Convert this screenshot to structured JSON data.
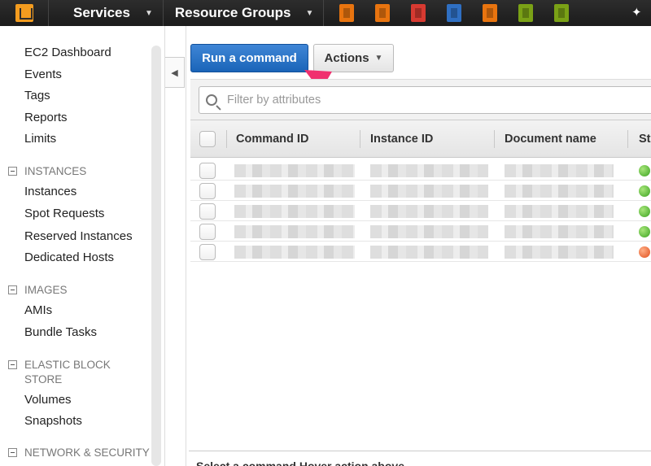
{
  "topbar": {
    "services_label": "Services",
    "resource_groups_label": "Resource Groups",
    "service_icons": [
      {
        "name": "ec2-icon",
        "color": "#e8740f"
      },
      {
        "name": "cloudfront-icon",
        "color": "#e8740f"
      },
      {
        "name": "ecs-icon",
        "color": "#d73a31"
      },
      {
        "name": "s3-icon",
        "color": "#2f6fc2"
      },
      {
        "name": "lambda-icon",
        "color": "#e8740f"
      },
      {
        "name": "iam-icon",
        "color": "#7aa116"
      },
      {
        "name": "beanstalk-icon",
        "color": "#7aa116"
      }
    ],
    "pin_icon": "pin-icon"
  },
  "sidebar": {
    "items": [
      {
        "label": "EC2 Dashboard"
      },
      {
        "label": "Events"
      },
      {
        "label": "Tags"
      },
      {
        "label": "Reports"
      },
      {
        "label": "Limits"
      }
    ],
    "sections": [
      {
        "title": "INSTANCES",
        "items": [
          "Instances",
          "Spot Requests",
          "Reserved Instances",
          "Dedicated Hosts"
        ]
      },
      {
        "title": "IMAGES",
        "items": [
          "AMIs",
          "Bundle Tasks"
        ]
      },
      {
        "title": "ELASTIC BLOCK STORE",
        "items": [
          "Volumes",
          "Snapshots"
        ]
      },
      {
        "title": "NETWORK & SECURITY",
        "items": []
      }
    ]
  },
  "toolbar": {
    "run_command_label": "Run a command",
    "actions_label": "Actions"
  },
  "filter": {
    "placeholder": "Filter by attributes"
  },
  "table": {
    "columns": [
      "Command ID",
      "Instance ID",
      "Document name",
      "St"
    ],
    "rows": [
      {
        "status": "green"
      },
      {
        "status": "green"
      },
      {
        "status": "green"
      },
      {
        "status": "green"
      },
      {
        "status": "red"
      }
    ]
  },
  "colors": {
    "accent": "#1a64b8",
    "status_success": "#3ca322",
    "status_failed": "#e0501d",
    "annotation_arrow": "#f0306e"
  },
  "footer": {
    "text": "Select a command Hover action above"
  }
}
